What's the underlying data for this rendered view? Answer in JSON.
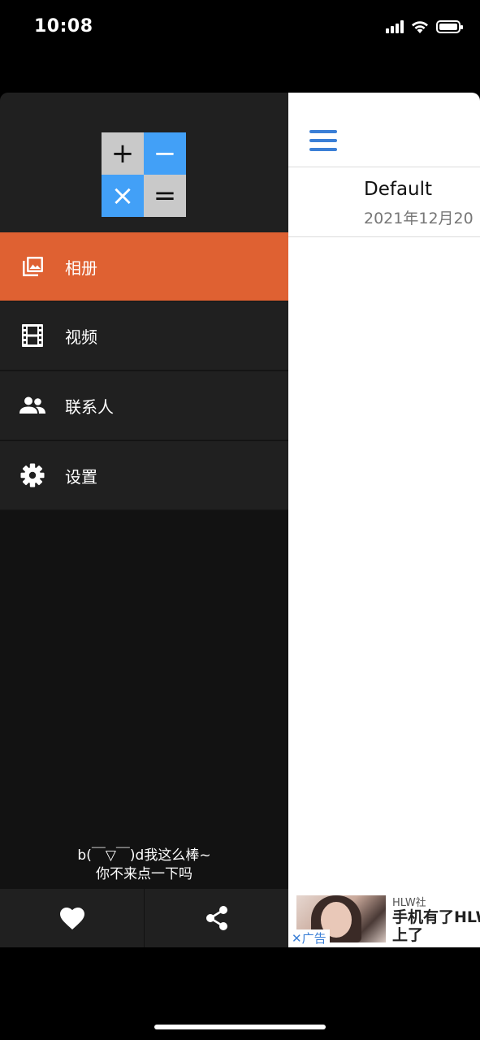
{
  "status_bar": {
    "time": "10:08"
  },
  "drawer": {
    "logo": {
      "cells": [
        "+",
        "−",
        "×",
        "="
      ]
    },
    "menu": [
      {
        "label": "相册",
        "icon": "photo-library-icon",
        "active": true
      },
      {
        "label": "视频",
        "icon": "film-icon",
        "active": false
      },
      {
        "label": "联系人",
        "icon": "people-icon",
        "active": false
      },
      {
        "label": "设置",
        "icon": "gear-icon",
        "active": false
      }
    ],
    "slogan_line1": "b(￣▽￣)d我这么棒~",
    "slogan_line2": "你不来点一下吗",
    "footer": {
      "left_icon": "heart-icon",
      "right_icon": "share-icon"
    }
  },
  "main": {
    "album": {
      "name": "Default",
      "date": "2021年12月20"
    }
  },
  "ad": {
    "badge": "✕广告",
    "source": "HLW社",
    "title_line1": "手机有了HLW",
    "title_line2": "上了"
  },
  "colors": {
    "drawer_bg": "#121212",
    "menu_bg": "#202020",
    "active_item": "#df6132",
    "logo_blue": "#42a0f7",
    "logo_grey": "#c9c9c9",
    "hamburger": "#3b7fd6"
  }
}
